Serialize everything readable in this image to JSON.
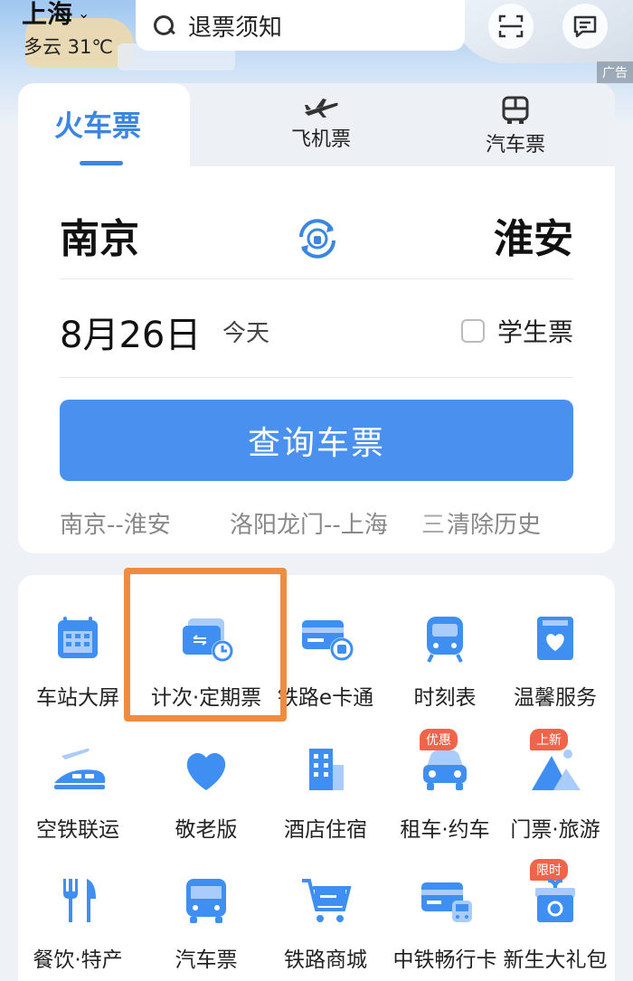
{
  "header": {
    "city": "上海",
    "weather": "多云 31℃",
    "search_placeholder": "退票须知",
    "ad_label": "广告"
  },
  "tabs": [
    {
      "label": "火车票",
      "active": true
    },
    {
      "label": "飞机票",
      "icon": "plane-icon"
    },
    {
      "label": "汽车票",
      "icon": "bus-icon"
    }
  ],
  "route": {
    "from": "南京",
    "to": "淮安"
  },
  "date": {
    "value": "8月26日",
    "relative": "今天"
  },
  "student_ticket": {
    "label": "学生票",
    "checked": false
  },
  "query_button": "查询车票",
  "history": {
    "items": [
      "南京--淮安",
      "洛阳龙门--上海"
    ],
    "more": "三",
    "clear": "清除历史"
  },
  "services": [
    {
      "label": "车站大屏",
      "icon": "calendar-icon"
    },
    {
      "label": "计次·定期票",
      "icon": "ticket-clock-icon",
      "highlighted": true
    },
    {
      "label": "铁路e卡通",
      "icon": "rail-card-icon"
    },
    {
      "label": "时刻表",
      "icon": "train-front-icon"
    },
    {
      "label": "温馨服务",
      "icon": "heart-box-icon"
    },
    {
      "label": "空铁联运",
      "icon": "plane-train-icon"
    },
    {
      "label": "敬老版",
      "icon": "heart-icon"
    },
    {
      "label": "酒店住宿",
      "icon": "building-icon"
    },
    {
      "label": "租车·约车",
      "icon": "car-icon",
      "badge": "优惠"
    },
    {
      "label": "门票·旅游",
      "icon": "mountain-icon",
      "badge": "上新"
    },
    {
      "label": "餐饮·特产",
      "icon": "fork-knife-icon"
    },
    {
      "label": "汽车票",
      "icon": "bus-icon"
    },
    {
      "label": "铁路商城",
      "icon": "cart-icon"
    },
    {
      "label": "中铁畅行卡",
      "icon": "card-train-icon"
    },
    {
      "label": "新生大礼包",
      "icon": "gift-icon",
      "badge": "限时"
    }
  ],
  "colors": {
    "accent": "#3a86e0",
    "button": "#4a90ef",
    "badge": "#f0654a",
    "highlight": "#f08c3f"
  }
}
